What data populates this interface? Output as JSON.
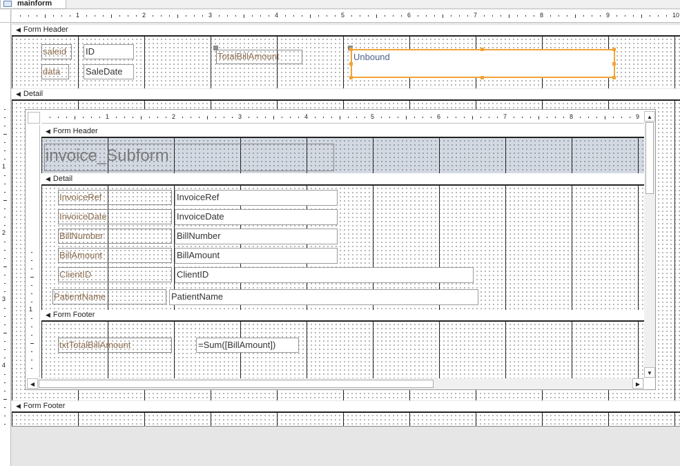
{
  "window": {
    "tab_title": "mainform"
  },
  "main_ruler": [
    "1",
    "2",
    "3",
    "4",
    "5",
    "6",
    "7",
    "8",
    "9",
    "10"
  ],
  "main_vruler": [
    "1",
    "2",
    "3",
    "4"
  ],
  "sub_ruler": [
    "1",
    "2",
    "3",
    "4",
    "5",
    "6",
    "7",
    "8",
    "9"
  ],
  "sub_vruler": [
    "1"
  ],
  "main": {
    "form_header": "Form Header",
    "detail": "Detail",
    "form_footer": "Form Footer",
    "controls": {
      "saleid_label": "saleid",
      "id_text": "ID",
      "data_label": "data",
      "saledate_text": "SaleDate",
      "total_label": "TotalBillAmount",
      "unbound_text": "Unbound"
    }
  },
  "subform": {
    "form_header": "Form Header",
    "title": "invoice_Subform",
    "detail": "Detail",
    "form_footer": "Form Footer",
    "fields": [
      {
        "label": "InvoiceRef",
        "value": "InvoiceRef"
      },
      {
        "label": "InvoiceDate",
        "value": "InvoiceDate"
      },
      {
        "label": "BillNumber",
        "value": "BillNumber"
      },
      {
        "label": "BillAmount",
        "value": "BillAmount"
      },
      {
        "label": "ClientID",
        "value": "ClientID"
      },
      {
        "label": "PatientName",
        "value": "PatientName"
      }
    ],
    "footer": {
      "label": "txtTotalBillAmount",
      "value": "=Sum([BillAmount])"
    }
  }
}
